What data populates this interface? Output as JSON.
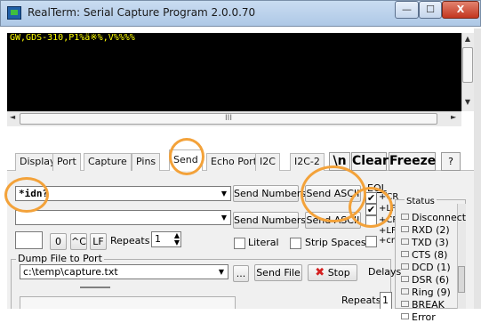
{
  "window": {
    "title": "RealTerm: Serial Capture Program 2.0.0.70",
    "min_label": "—",
    "max_label": "☐",
    "close_label": "X"
  },
  "terminal": {
    "text": "GW,GDS-310,P1%ä※%,V%%%%"
  },
  "scrollbar": {
    "hthumb_grip": "III",
    "up": "▲",
    "down": "▼",
    "left": "◄",
    "right": "►"
  },
  "tabs": [
    {
      "label": "Display"
    },
    {
      "label": "Port"
    },
    {
      "label": "Capture"
    },
    {
      "label": "Pins"
    },
    {
      "label": "Send"
    },
    {
      "label": "Echo Port"
    },
    {
      "label": "I2C"
    },
    {
      "label": "I2C-2"
    }
  ],
  "toolbar": {
    "newline_label": "\\n",
    "clear_label": "Clear",
    "freeze_label": "Freeze",
    "help_label": "?"
  },
  "send": {
    "input1_value": "*idn?",
    "input2_value": "",
    "send_numbers_label": "Send Numbers",
    "send_ascii_label": "Send ASCII",
    "zero_label": "0",
    "ctrl_c_label": "^C",
    "lf_label": "LF",
    "repeats_label": "Repeats",
    "repeats_value": "1",
    "literal_label": "Literal",
    "strip_spaces_label": "Strip Spaces"
  },
  "eol": {
    "label": "EOL",
    "items": [
      "+CR",
      "+LF",
      "+CR",
      "+LF",
      "+cr"
    ]
  },
  "dump": {
    "label": "Dump File to Port",
    "path_value": "c:\\temp\\capture.txt",
    "browse_label": "...",
    "send_file_label": "Send File",
    "stop_label": "Stop",
    "delays_label": "Delays",
    "repeats_label": "Repeats",
    "repeats_value": "1"
  },
  "status": {
    "label": "Status",
    "items": [
      "Disconnect",
      "RXD (2)",
      "TXD (3)",
      "CTS (8)",
      "DCD (1)",
      "DSR (6)",
      "Ring (9)",
      "BREAK",
      "Error"
    ]
  },
  "colors": {
    "terminal_bg": "#000000",
    "terminal_text": "#ffff00",
    "highlight": "#f3a23a",
    "stop_icon": "#d42020"
  }
}
